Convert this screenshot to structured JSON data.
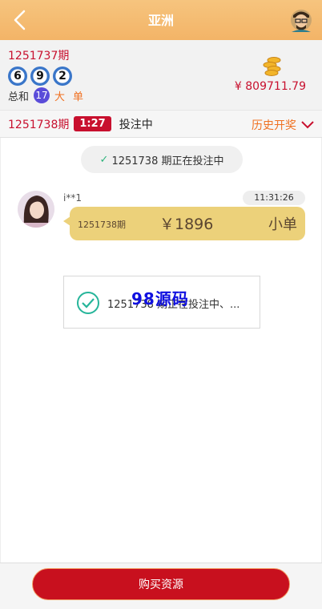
{
  "header": {
    "title": "亚洲"
  },
  "last_draw": {
    "period": "1251737期",
    "balls": [
      "6",
      "9",
      "2"
    ],
    "sum_label": "总和",
    "sum_value": "17",
    "size": "大",
    "parity": "单",
    "balance": "¥ 809711.79"
  },
  "current": {
    "period": "1251738期",
    "countdown": "1:27",
    "status": "投注中",
    "history_label": "历史开奖"
  },
  "chat": {
    "notice": "1251738 期正在投注中",
    "message": {
      "user": "i**1",
      "time": "11:31:26",
      "period": "1251738期",
      "amount": "￥1896",
      "bet": "小单"
    }
  },
  "popup": {
    "text": "1251738 期正在投注中、...",
    "watermark": "98源码"
  },
  "footer": {
    "buy_label": "购买资源"
  },
  "colors": {
    "accent_red": "#c8102e",
    "header_orange": "#f3b467",
    "bubble_gold": "#ecd17a",
    "orange_text": "#f07020"
  }
}
